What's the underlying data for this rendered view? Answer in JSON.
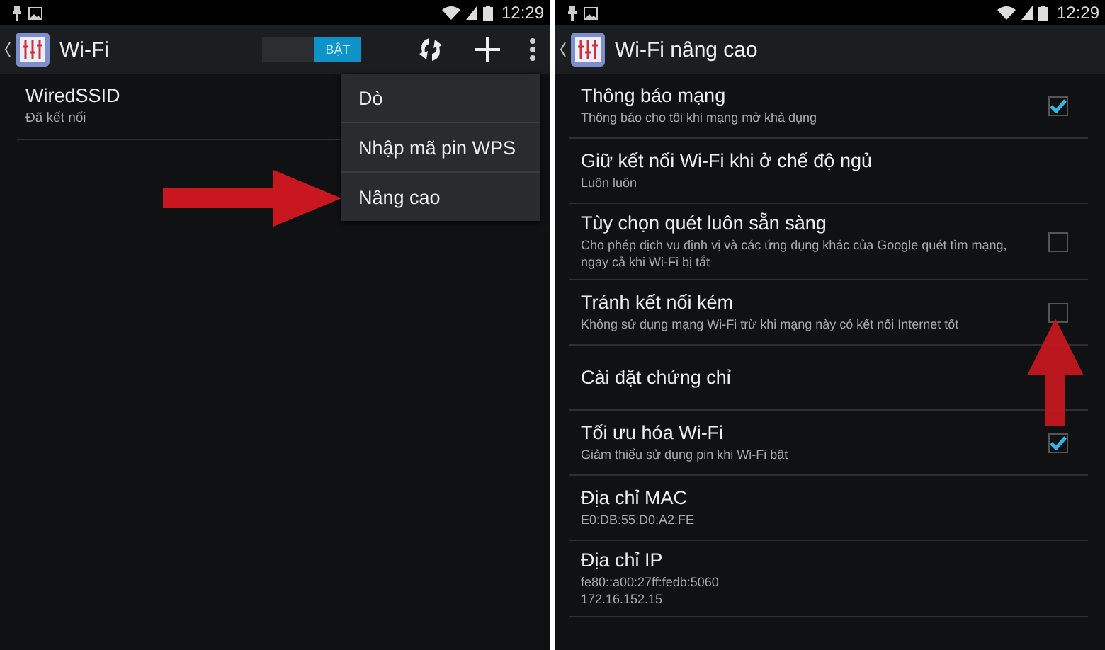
{
  "left_screen": {
    "status_bar": {
      "time": "12:29"
    },
    "action_bar": {
      "title": "Wi-Fi",
      "toggle": {
        "label": "BẬT",
        "on": true
      }
    },
    "networks": [
      {
        "name": "WiredSSID",
        "status": "Đã kết nối"
      }
    ],
    "menu": [
      {
        "label": "Dò"
      },
      {
        "label": "Nhập mã pin WPS"
      },
      {
        "label": "Nâng cao"
      }
    ],
    "annotation": {
      "kind": "arrow-right"
    }
  },
  "right_screen": {
    "status_bar": {
      "time": "12:29"
    },
    "action_bar": {
      "title": "Wi-Fi nâng cao"
    },
    "settings": [
      {
        "kind": "checkbox",
        "title": "Thông báo mạng",
        "summary": "Thông báo cho tôi khi mạng mở khả dụng",
        "checked": true
      },
      {
        "kind": "plain",
        "title": "Giữ kết nối Wi-Fi khi ở chế độ ngủ",
        "summary": "Luôn luôn"
      },
      {
        "kind": "checkbox",
        "title": "Tùy chọn quét luôn sẵn sàng",
        "summary": "Cho phép dịch vụ định vị và các ứng dụng khác của Google quét tìm mạng, ngay cả khi Wi-Fi bị tắt",
        "checked": false
      },
      {
        "kind": "checkbox",
        "title": "Tránh kết nối kém",
        "summary": "Không sử dụng mạng Wi-Fi trừ khi mạng này có kết nối Internet tốt",
        "checked": false
      },
      {
        "kind": "plain",
        "title": "Cài đặt chứng chỉ"
      },
      {
        "kind": "checkbox",
        "title": "Tối ưu hóa Wi-Fi",
        "summary": "Giảm thiểu sử dụng pin khi Wi-Fi bật",
        "checked": true
      },
      {
        "kind": "plain",
        "title": "Địa chỉ MAC",
        "summary": "E0:DB:55:D0:A2:FE"
      },
      {
        "kind": "plain",
        "title": "Địa chỉ IP",
        "summary": "fe80::a00:27ff:fedb:5060\n172.16.152.15"
      }
    ],
    "annotation": {
      "kind": "arrow-up"
    }
  }
}
